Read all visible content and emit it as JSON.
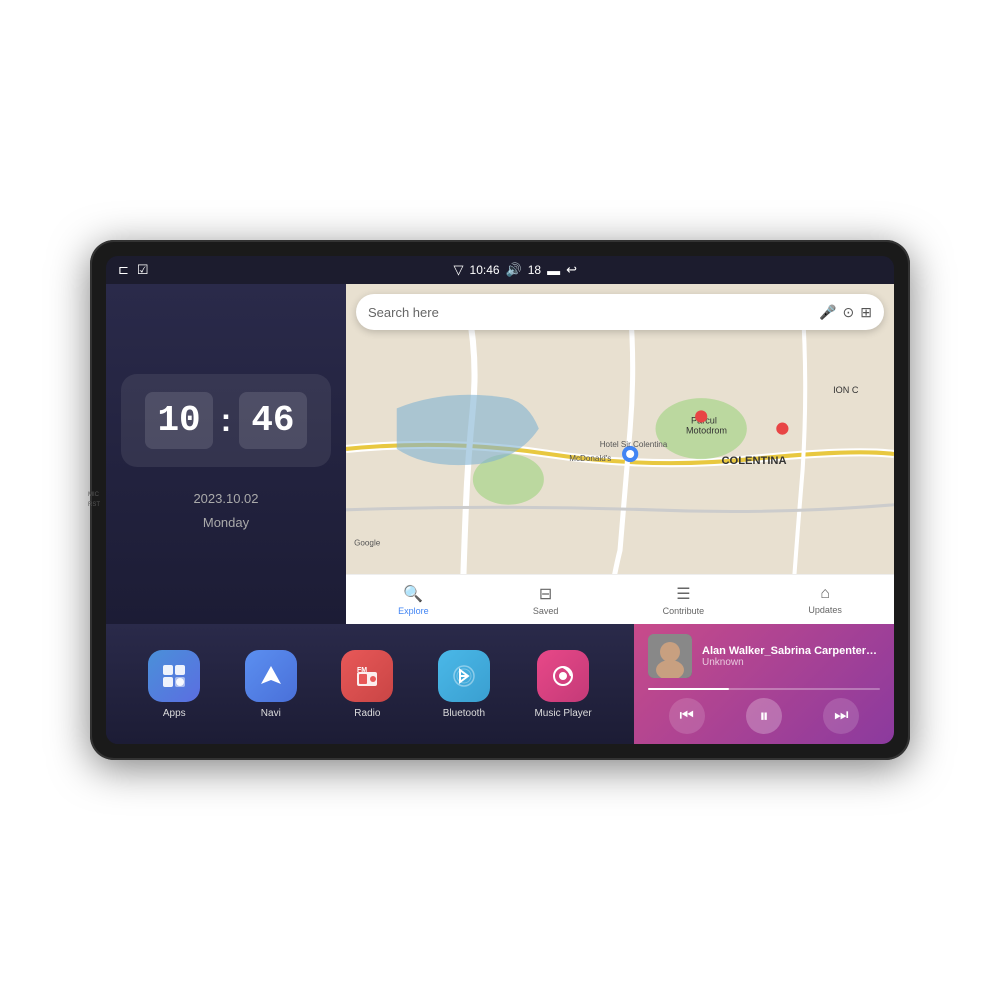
{
  "device": {
    "side_labels": [
      "MIC",
      "RST"
    ]
  },
  "status_bar": {
    "left_icons": [
      "⊏",
      "☑"
    ],
    "signal_icon": "▽",
    "time": "10:46",
    "volume_icon": "🔊",
    "battery_level": "18",
    "battery_icon": "▬",
    "back_icon": "↩"
  },
  "clock": {
    "hour": "10",
    "minute": "46",
    "date": "2023.10.02",
    "day": "Monday"
  },
  "map": {
    "search_placeholder": "Search here",
    "nav_items": [
      {
        "label": "Explore",
        "icon": "🔍",
        "active": true
      },
      {
        "label": "Saved",
        "icon": "⊟",
        "active": false
      },
      {
        "label": "Contribute",
        "icon": "☰",
        "active": false
      },
      {
        "label": "Updates",
        "icon": "⌂",
        "active": false
      }
    ]
  },
  "apps": [
    {
      "id": "apps",
      "label": "Apps",
      "icon": "⊞",
      "class": "icon-apps"
    },
    {
      "id": "navi",
      "label": "Navi",
      "icon": "▲",
      "class": "icon-navi"
    },
    {
      "id": "radio",
      "label": "Radio",
      "icon": "📻",
      "class": "icon-radio"
    },
    {
      "id": "bluetooth",
      "label": "Bluetooth",
      "icon": "⟨",
      "class": "icon-bluetooth"
    },
    {
      "id": "music-player",
      "label": "Music Player",
      "icon": "♪",
      "class": "icon-music"
    }
  ],
  "music_player": {
    "title": "Alan Walker_Sabrina Carpenter_F...",
    "artist": "Unknown",
    "progress_percent": 35,
    "prev_icon": "⏮",
    "play_icon": "⏸",
    "next_icon": "⏭"
  }
}
